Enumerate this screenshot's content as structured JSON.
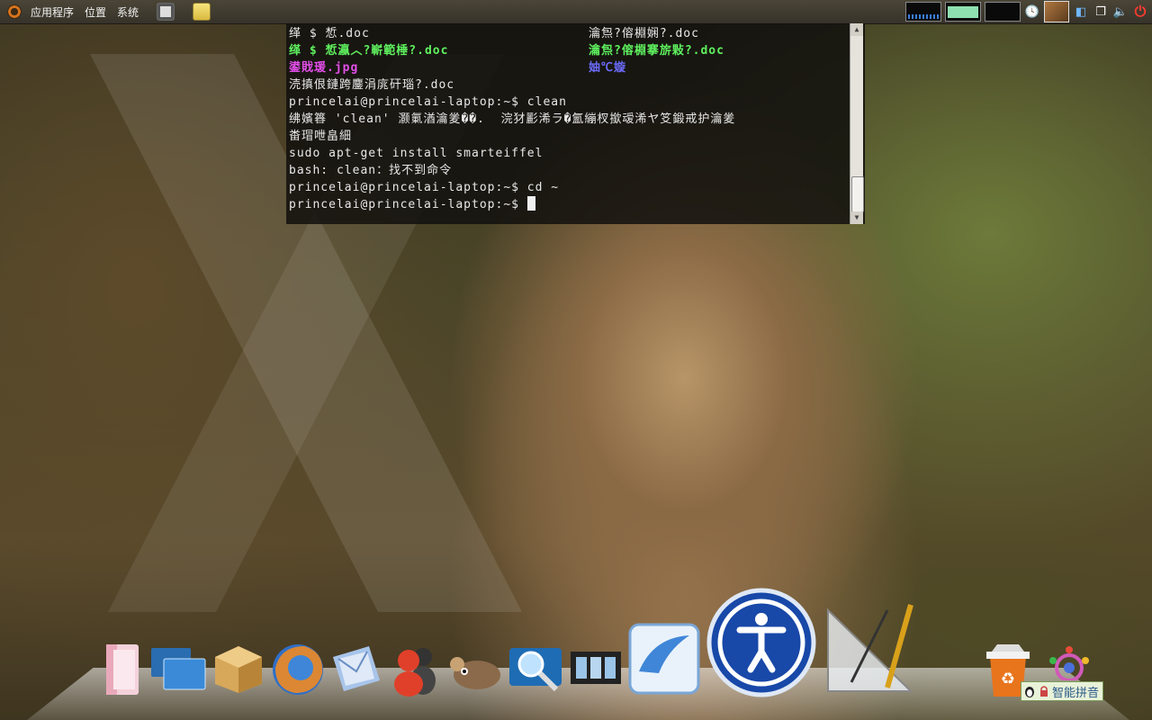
{
  "top_panel": {
    "menus": {
      "applications": "应用程序",
      "places": "位置",
      "system": "系统"
    },
    "icons": [
      "ubuntu-logo",
      "system-monitor-launcher",
      "notes-launcher",
      "cpu-graph",
      "memory-graph",
      "network-graph",
      "clock-icon",
      "user-photo",
      "network-icon",
      "windows-icon",
      "volume-icon",
      "power-icon"
    ]
  },
  "terminal": {
    "line1_left": "缂 $ 惁.doc",
    "line1_right": "瀹炰?傛棩娴?.doc",
    "line2_left": "缂 $ 惁瀛︿?嶄範棰?.doc",
    "line2_right": "瀹炰?傛棩搴旂敤?.doc",
    "line3_left": "鍙戝瑗.jpg",
    "line3_right": "妯℃嫙",
    "line4": "涜搷佷鏈跨鏖涓庣矸瑙?.doc",
    "line5": "princelai@princelai-laptop:~$ clean",
    "line6": "绋嬪簭 'clean' 灏氭湭瀹夎��.  浣犲彲浠ラ�氳繃杈撳叆浠ヤ笅鍛戒护瀹夎",
    "line7": "畨瑁呭畠細",
    "line8": "sudo apt-get install smarteiffel",
    "line9": "bash: clean：找不到命令",
    "line10": "princelai@princelai-laptop:~$ cd ~",
    "line11": "princelai@princelai-laptop:~$ "
  },
  "dock": {
    "items": [
      "home-folder",
      "desktop-switcher",
      "package-manager",
      "firefox",
      "mail",
      "messenger",
      "gimp",
      "search",
      "video-player",
      "openoffice-writer",
      "accessibility",
      "geometry-tools",
      "trash",
      "settings"
    ],
    "ime_label": "智能拼音"
  },
  "colors": {
    "terminal_bg": "#12100e",
    "ls_exec": "#5ef05e",
    "ls_image": "#e24ee8",
    "ls_dir": "#6a6af7"
  }
}
